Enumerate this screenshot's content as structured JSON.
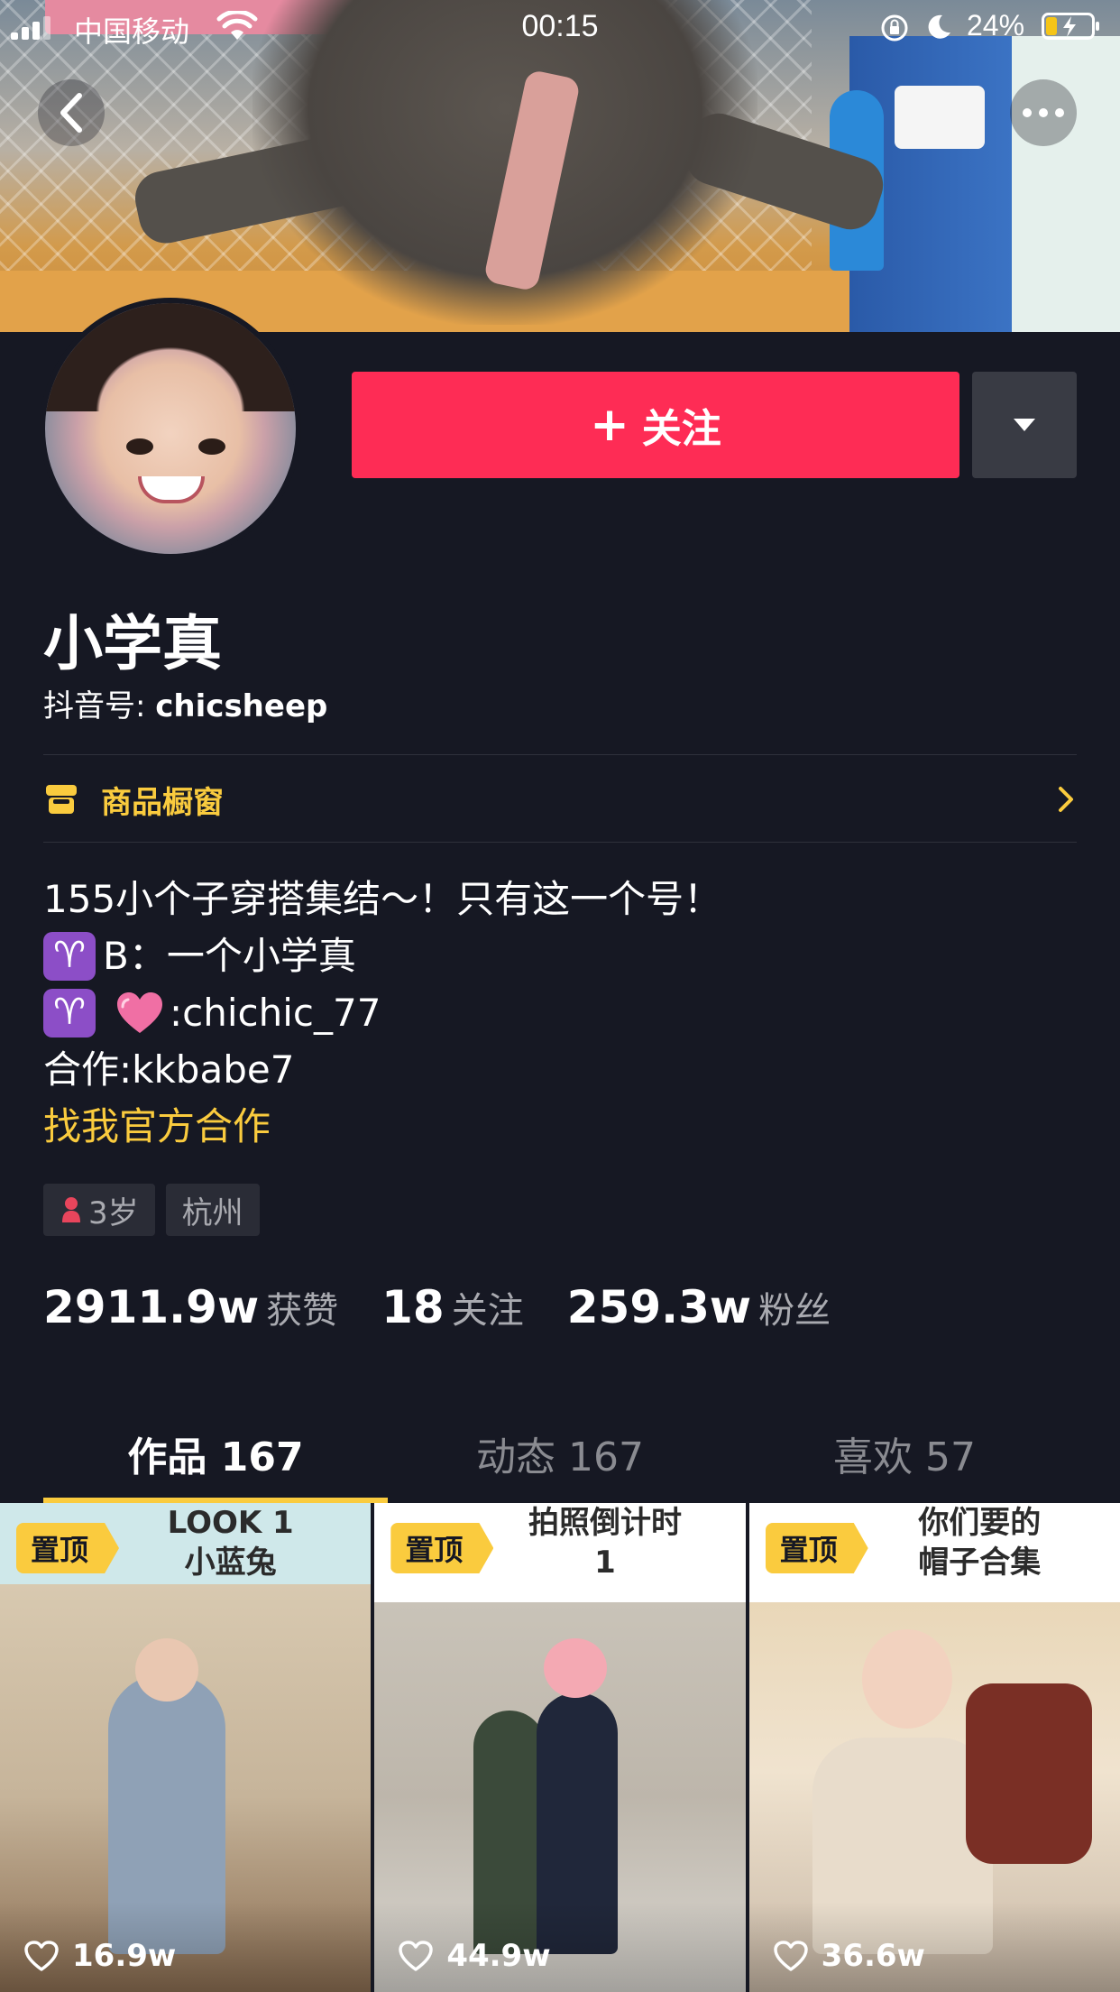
{
  "status_bar": {
    "carrier": "中国移动",
    "time": "00:15",
    "battery_percent": "24%"
  },
  "profile": {
    "follow_label": "关注",
    "nickname": "小学真",
    "douyin_id_label": "抖音号:",
    "douyin_id": "chicsheep",
    "shop_label": "商品橱窗",
    "bio": {
      "line1": "155小个子穿搭集结～！只有这一个号！",
      "line2_text": "B：一个小学真",
      "line3_text": ":chichic_77",
      "line4": "合作:kkbabe7",
      "line5": "找我官方合作"
    },
    "aries_symbol": "♈",
    "tags": {
      "age": "3岁",
      "city": "杭州"
    },
    "stats": {
      "likes_num": "2911.9w",
      "likes_label": "获赞",
      "following_num": "18",
      "following_label": "关注",
      "followers_num": "259.3w",
      "followers_label": "粉丝"
    }
  },
  "tabs": [
    {
      "label": "作品 167",
      "active": true
    },
    {
      "label": "动态 167",
      "active": false
    },
    {
      "label": "喜欢 57",
      "active": false
    }
  ],
  "videos": [
    {
      "pinned_label": "置顶",
      "caption_1": "LOOK 1",
      "caption_2": "小蓝兔",
      "likes": "16.9w"
    },
    {
      "pinned_label": "置顶",
      "caption_1": "拍照倒计时",
      "caption_2": "1",
      "likes": "44.9w"
    },
    {
      "pinned_label": "置顶",
      "caption_1": "你们要的",
      "caption_2": "帽子合集",
      "likes": "36.6w"
    }
  ],
  "colors": {
    "background": "#161823",
    "follow_button": "#fe2c55",
    "accent_yellow": "#facb3e"
  }
}
